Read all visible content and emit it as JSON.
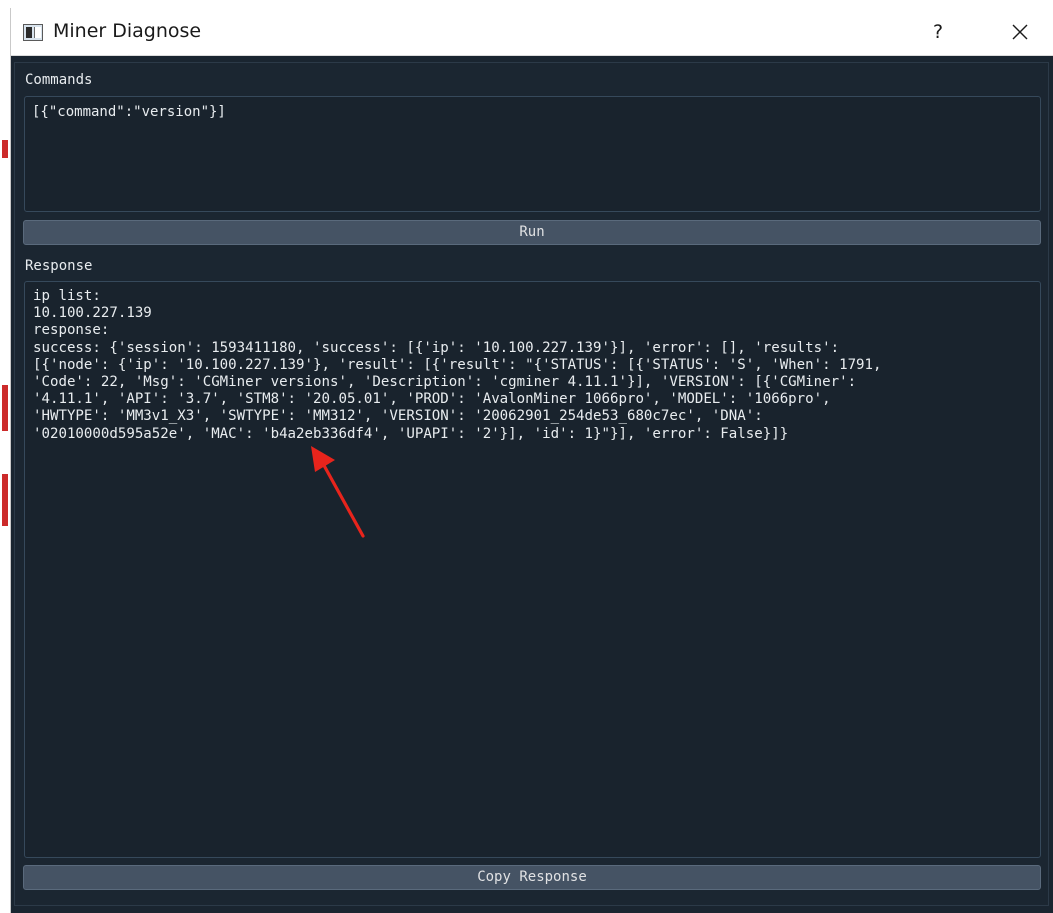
{
  "window": {
    "title": "Miner Diagnose",
    "help_label": "?",
    "icons": {
      "app": "app-window-icon",
      "close": "close-icon"
    }
  },
  "commands": {
    "label": "Commands",
    "value": "[{\"command\":\"version\"}]"
  },
  "run_button": {
    "label": "Run"
  },
  "response": {
    "label": "Response",
    "lines": [
      "ip list:",
      "10.100.227.139",
      "response:",
      "success: {'session': 1593411180, 'success': [{'ip': '10.100.227.139'}], 'error': [], 'results':",
      "[{'node': {'ip': '10.100.227.139'}, 'result': [{'result': \"{'STATUS': [{'STATUS': 'S', 'When': 1791,",
      "'Code': 22, 'Msg': 'CGMiner versions', 'Description': 'cgminer 4.11.1'}], 'VERSION': [{'CGMiner':",
      "'4.11.1', 'API': '3.7', 'STM8': '20.05.01', 'PROD': 'AvalonMiner 1066pro', 'MODEL': '1066pro',",
      "'HWTYPE': 'MM3v1_X3', 'SWTYPE': 'MM312', 'VERSION': '20062901_254de53_680c7ec', 'DNA':",
      "'02010000d595a52e', 'MAC': 'b4a2eb336df4', 'UPAPI': '2'}], 'id': 1}\"}], 'error': False}]}"
    ]
  },
  "copy_button": {
    "label": "Copy Response"
  },
  "colors": {
    "background": "#1a2530",
    "accent_button": "#455364",
    "text": "#e8ecef",
    "annotation_arrow": "#e8241c"
  }
}
